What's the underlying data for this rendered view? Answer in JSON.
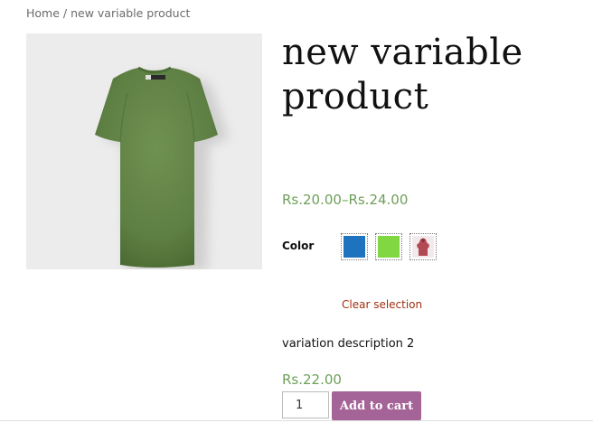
{
  "breadcrumb": {
    "home": "Home",
    "separator": " / ",
    "current": "new variable product"
  },
  "product": {
    "title": "new variable product",
    "price_range": "Rs.20.00–Rs.24.00",
    "image_icon": "green-tshirt-back-image"
  },
  "variations": {
    "label": "Color",
    "swatches": [
      {
        "name": "blue",
        "color": "#1e73be"
      },
      {
        "name": "green",
        "color": "#81d742"
      },
      {
        "name": "red-hoodie-image",
        "color": "#b24a55"
      }
    ],
    "clear_label": "Clear selection",
    "description": "variation description 2",
    "price": "Rs.22.00"
  },
  "cart": {
    "quantity": "1",
    "add_label": "Add to cart",
    "button_color": "#a46497"
  },
  "colors": {
    "price": "#6ea05a",
    "clear_link": "#a0300f"
  }
}
